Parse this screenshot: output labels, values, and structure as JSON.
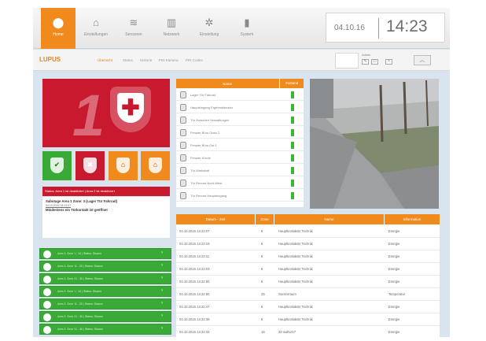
{
  "topnav": {
    "items": [
      {
        "label": "Home",
        "icon": "home-alarm-icon",
        "active": true
      },
      {
        "label": "Einstellungen",
        "icon": "house-icon"
      },
      {
        "label": "Sensoren",
        "icon": "signal-icon"
      },
      {
        "label": "Netzwerk",
        "icon": "building-icon"
      },
      {
        "label": "Einstellung",
        "icon": "gear-icon"
      },
      {
        "label": "System",
        "icon": "bar-chart-icon"
      }
    ],
    "date": "04.10.16",
    "time": "14:23"
  },
  "subnav": {
    "logo": "LUPUS",
    "links": [
      "Übersicht",
      "Status",
      "Historie",
      "PIN Kamera",
      "PIN Codes"
    ],
    "user": "Admin"
  },
  "alarm": {
    "area_number": "1",
    "status_text": "Status: Area 1 ist deaktiviert | Area 2 ist deaktiviert",
    "message_line1": "Sabotage Area 1 Zone: 3 (Lager Tür Fahrrad)",
    "message_line2": "04.10.2016 14:23:07",
    "message_line3": "Mindestens ein Türkontakt ist geöffnet",
    "colors": {
      "alarm": "#c8192e",
      "accent": "#f18a1d",
      "ok": "#39aa35"
    }
  },
  "modes": [
    {
      "icon": "shield-check-icon",
      "bg": "#39aa35",
      "fg": "#1f6d1c",
      "glyph": "✔"
    },
    {
      "icon": "shield-alarm-icon",
      "bg": "#c8192e",
      "fg": "#ffffff",
      "glyph": "✖"
    },
    {
      "icon": "shield-home-icon",
      "bg": "#f18a1d",
      "fg": "#a9560a",
      "glyph": "⌂"
    },
    {
      "icon": "shield-home2-icon",
      "bg": "#f18a1d",
      "fg": "#a9560a",
      "glyph": "⌂"
    }
  ],
  "areas": [
    "Area 1: Zone 1 - 10 | Status: Disarm",
    "Area 1: Zone 11 - 20 | Status: Disarm",
    "Area 1: Zone 21 - 30 | Status: Disarm",
    "Area 2: Zone 1 - 10 | Status: Disarm",
    "Area 2: Zone 11 - 20 | Status: Disarm",
    "Area 2: Zone 21 - 30 | Status: Disarm",
    "Area 2: Zone 31 - 40 | Status: Disarm"
  ],
  "sensors": {
    "headers": [
      "Name",
      "Zustand"
    ],
    "rows": [
      "Lager Tür Fahrrad",
      "Haupteingang Ergebnisfenster",
      "Tür Zwischen Verwaltungen",
      "Fenster Büro Oben 2",
      "Fenster Büro Ost 1",
      "Fenster Küche",
      "Tür Werkstatt",
      "Tür Renner Nord-West",
      "Tür Renner Haupteingang"
    ]
  },
  "events": {
    "headers": [
      "Datum - Zeit",
      "Zone",
      "Name",
      "Information"
    ],
    "rows": [
      [
        "04.10.2016 14:23:07",
        "8",
        "Hauptkontakter Technik",
        "Energie"
      ],
      [
        "04.10.2016 14:23:19",
        "8",
        "Hauptkontakter Technik",
        "Energie"
      ],
      [
        "04.10.2016 14:23:11",
        "8",
        "Hauptkontakter Technik",
        "Energie"
      ],
      [
        "04.10.2016 14:23:03",
        "8",
        "Hauptkontakter Technik",
        "Energie"
      ],
      [
        "04.10.2016 14:22:55",
        "8",
        "Hauptkontakter Technik",
        "Energie"
      ],
      [
        "04.10.2016 14:22:55",
        "25",
        "Sensorraum",
        "Temperatur"
      ],
      [
        "04.10.2016 14:22:47",
        "8",
        "Hauptkontakter Technik",
        "Energie"
      ],
      [
        "04.10.2016 14:22:39",
        "8",
        "Hauptkontakter Technik",
        "Energie"
      ],
      [
        "04.10.2016 14:22:32",
        "16",
        "Z0 waltUG7",
        "Energie"
      ]
    ]
  }
}
